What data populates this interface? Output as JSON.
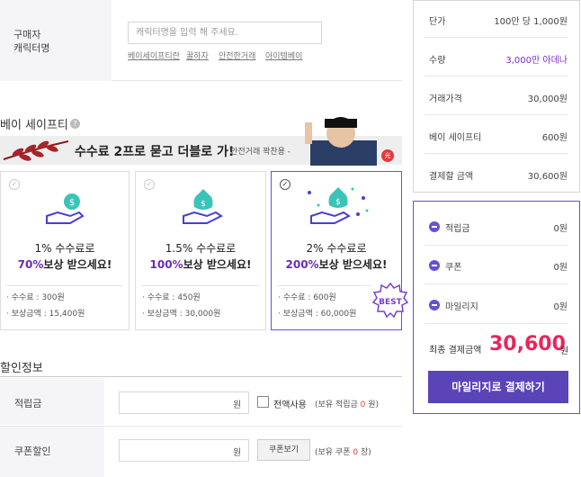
{
  "buyer": {
    "label": "구매자\n캐릭터명",
    "placeholder": "캐릭터명을 입력 해 주세요.",
    "links": [
      "베이세이프티란",
      "꿀하자",
      "안전한거래",
      "아이템베이"
    ]
  },
  "bay_safety": {
    "title": "베이 세이프티",
    "info_icon": "question-icon",
    "banner_main": "수수료 2프로 묻고 더블로 가!",
    "banner_sub": "- 안전거래 꽉찬용 -",
    "banner_badge": "光",
    "options": [
      {
        "line1": "1% 수수료로",
        "line2_bold": "70%",
        "line2_rest": "보상 받으세요!",
        "fee": "· 수수료 : 300원",
        "reward": "· 보상금액 : 15,400원",
        "selected": false
      },
      {
        "line1": "1.5% 수수료로",
        "line2_bold": "100%",
        "line2_rest": "보상 받으세요!",
        "fee": "· 수수료 : 450원",
        "reward": "· 보상금액 : 30,000원",
        "selected": false
      },
      {
        "line1": "2% 수수료로",
        "line2_bold": "200%",
        "line2_rest": "보상 받으세요!",
        "fee": "· 수수료 : 600원",
        "reward": "· 보상금액 : 60,000원",
        "selected": true
      }
    ],
    "best_label": "BEST",
    "accent": "#6a2cb8"
  },
  "discount": {
    "title": "할인정보",
    "points_label": "적립금",
    "points_unit": "원",
    "use_all_label": "전액사용",
    "points_hint_pre": "(보유 적립금 ",
    "points_hint_val": "0",
    "points_hint_post": " 원)",
    "coupon_label": "쿠폰할인",
    "coupon_unit": "원",
    "coupon_button": "쿠폰보기",
    "coupon_hint_pre": "(보유 쿠폰 ",
    "coupon_hint_val": "0",
    "coupon_hint_post": " 장)"
  },
  "summary": {
    "rows": [
      {
        "label": "단가",
        "value": "100만 당 1,000원"
      },
      {
        "label": "수량",
        "value": "3,000만 아데나"
      },
      {
        "label": "거래가격",
        "value": "30,000원"
      },
      {
        "label": "베이 세이프티",
        "value": "600원"
      },
      {
        "label": "결제할 금액",
        "value": "30,600원"
      }
    ]
  },
  "deductions": {
    "rows": [
      {
        "label": "적립금",
        "value": "0원"
      },
      {
        "label": "쿠폰",
        "value": "0원"
      },
      {
        "label": "마일리지",
        "value": "0원"
      }
    ],
    "final_label": "최종 결제금액",
    "final_amount": "30,600",
    "final_unit": "원",
    "pay_button": "마일리지로 결제하기",
    "pay_color": "#5b43b8",
    "amount_color": "#e8265c"
  }
}
